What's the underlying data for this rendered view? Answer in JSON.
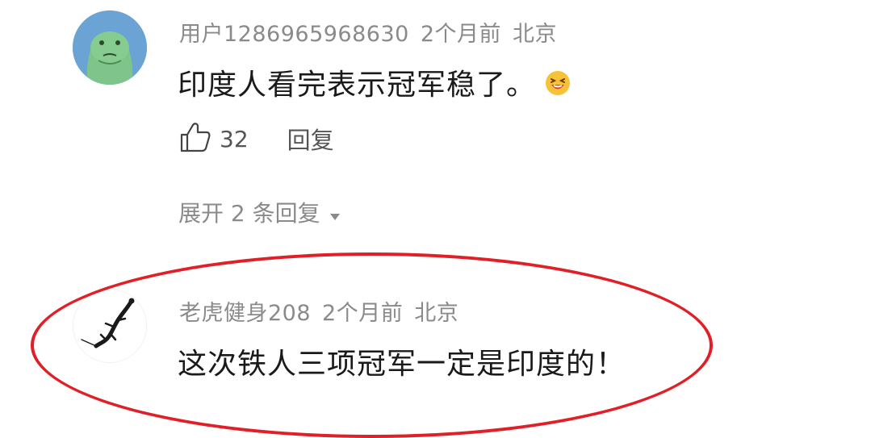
{
  "comments": [
    {
      "username": "用户1286965968630",
      "time": "2个月前",
      "location": "北京",
      "text": "印度人看完表示冠军稳了。",
      "emoji": "laughing-emoji",
      "likes": "32",
      "reply_label": "回复",
      "expand_label": "展开 2 条回复",
      "avatar": "green-frog-avatar"
    },
    {
      "username": "老虎健身208",
      "time": "2个月前",
      "location": "北京",
      "text": "这次铁人三项冠军一定是印度的！",
      "avatar": "gecko-avatar"
    }
  ],
  "colors": {
    "highlight": "#e01f26",
    "meta": "#8a8a8a",
    "avatar_bg": "#6ba4d4"
  }
}
